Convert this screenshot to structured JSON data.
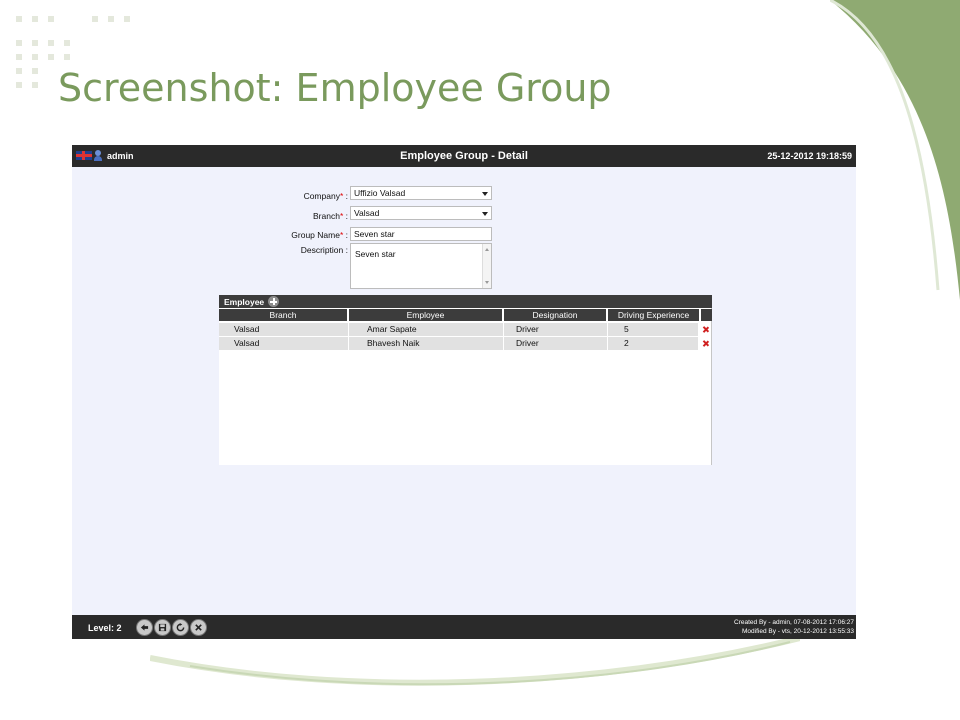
{
  "slide": {
    "title": "Screenshot: Employee Group"
  },
  "topbar": {
    "username": "admin",
    "window_title": "Employee Group - Detail",
    "datetime": "25-12-2012 19:18:59"
  },
  "form": {
    "company": {
      "label": "Company",
      "value": "Uffizio Valsad"
    },
    "branch": {
      "label": "Branch",
      "value": "Valsad"
    },
    "group_name": {
      "label": "Group Name",
      "value": "Seven star"
    },
    "description": {
      "label": "Description",
      "value": "Seven star"
    }
  },
  "grid": {
    "title": "Employee",
    "columns": [
      "Branch",
      "Employee",
      "Designation",
      "Driving Experience"
    ],
    "rows": [
      {
        "branch": "Valsad",
        "employee": "Amar  Sapate",
        "designation": "Driver",
        "experience": "5"
      },
      {
        "branch": "Valsad",
        "employee": "Bhavesh  Naik",
        "designation": "Driver",
        "experience": "2"
      }
    ]
  },
  "bottombar": {
    "level": "Level: 2",
    "buttons": [
      "back-icon",
      "save-icon",
      "refresh-icon",
      "close-icon"
    ],
    "created_by": "Created By - admin, 07-08-2012 17:06:27",
    "modified_by": "Modified By - vts, 20-12-2012 13:55:33"
  },
  "colors": {
    "title_green": "#7a9a5d",
    "bar_dark": "#2a2a2a",
    "panel_bg": "#f0f2fc",
    "required_red": "#dd0000"
  }
}
